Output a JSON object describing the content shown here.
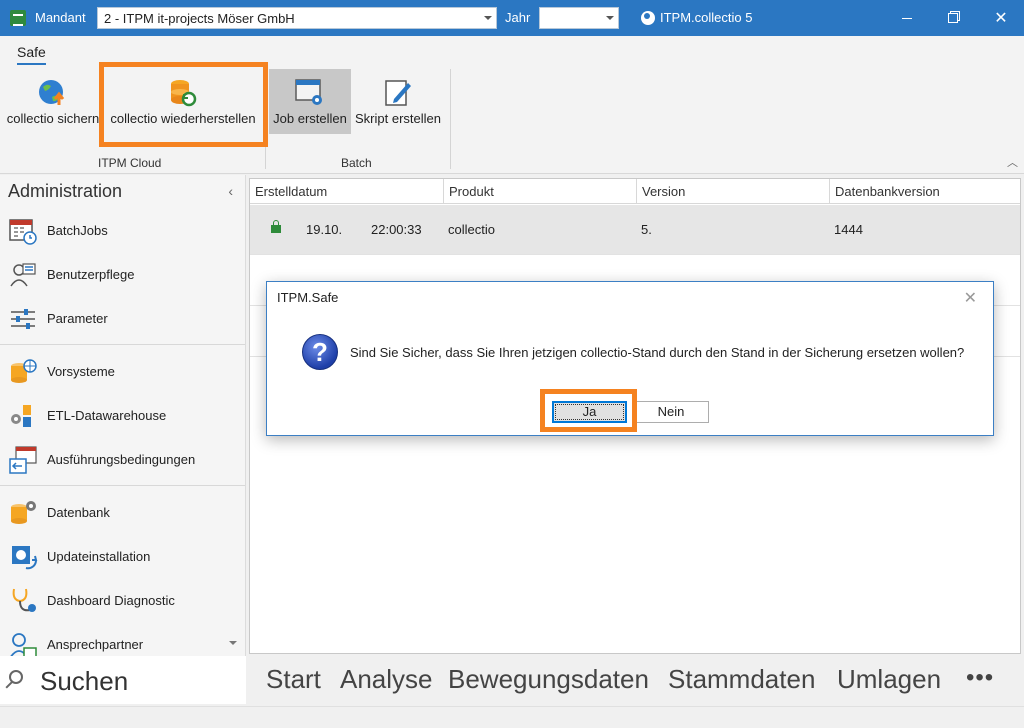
{
  "titlebar": {
    "mandant_label": "Mandant",
    "mandant_value": "2 - ITPM it-projects Möser GmbH",
    "jahr_label": "Jahr",
    "jahr_value": "",
    "app_title": "ITPM.collectio 5",
    "close_glyph": "✕"
  },
  "ribbon": {
    "tab": "Safe",
    "buttons": [
      {
        "label": "collectio sichern",
        "icon": "globe-upload-icon"
      },
      {
        "label": "collectio wiederherstellen",
        "icon": "database-restore-icon"
      },
      {
        "label": "Job erstellen",
        "icon": "window-gear-icon"
      },
      {
        "label": "Skript erstellen",
        "icon": "pencil-edit-icon"
      }
    ],
    "groups": [
      "ITPM Cloud",
      "Batch"
    ],
    "collapse_glyph": "︿"
  },
  "sidebar": {
    "title": "Administration",
    "collapse_glyph": "‹",
    "items": [
      {
        "label": "BatchJobs",
        "icon": "calendar-clock-icon"
      },
      {
        "label": "Benutzerpflege",
        "icon": "user-list-icon"
      },
      {
        "label": "Parameter",
        "icon": "sliders-icon"
      },
      {
        "label": "Vorsysteme",
        "icon": "database-globe-icon"
      },
      {
        "label": "ETL-Datawarehouse",
        "icon": "etl-gears-icon"
      },
      {
        "label": "Ausführungsbedingungen",
        "icon": "table-arrow-icon"
      },
      {
        "label": "Datenbank",
        "icon": "database-gear-icon"
      },
      {
        "label": "Updateinstallation",
        "icon": "update-install-icon"
      },
      {
        "label": "Dashboard Diagnostic",
        "icon": "stethoscope-icon"
      },
      {
        "label": "Ansprechpartner",
        "icon": "contact-mail-icon"
      }
    ]
  },
  "grid": {
    "columns": [
      "Erstelldatum",
      "Produkt",
      "Version",
      "Datenbankversion"
    ],
    "rows": [
      {
        "date": "19.10.",
        "time": "22:00:33",
        "product": "collectio",
        "version": "5.",
        "dbversion": "1444",
        "locked": true
      }
    ]
  },
  "dialog": {
    "title": "ITPM.Safe",
    "message": "Sind Sie Sicher, dass Sie Ihren jetzigen collectio-Stand durch den Stand in der Sicherung ersetzen wollen?",
    "yes_label": "Ja",
    "no_label": "Nein",
    "close_glyph": "✕",
    "question_glyph": "?"
  },
  "bottom": {
    "search_label": "Suchen",
    "nav": [
      "Start",
      "Analyse",
      "Bewegungsdaten",
      "Stammdaten",
      "Umlagen"
    ],
    "more_glyph": "•••"
  },
  "colors": {
    "titlebar": "#2b77c2",
    "highlight": "#f58220",
    "lock": "#2e8b3a"
  }
}
